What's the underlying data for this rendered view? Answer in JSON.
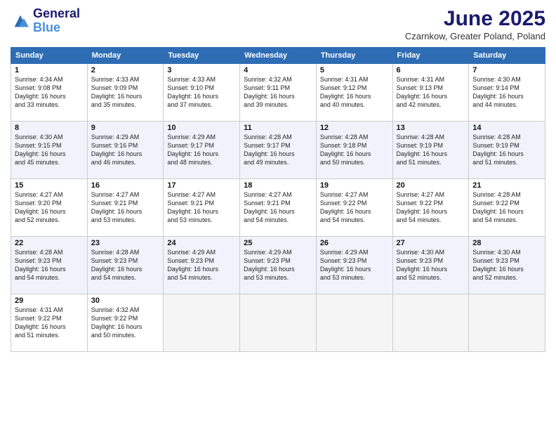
{
  "header": {
    "logo_line1": "General",
    "logo_line2": "Blue",
    "month_title": "June 2025",
    "location": "Czarnkow, Greater Poland, Poland"
  },
  "days_of_week": [
    "Sunday",
    "Monday",
    "Tuesday",
    "Wednesday",
    "Thursday",
    "Friday",
    "Saturday"
  ],
  "weeks": [
    [
      {
        "day": "1",
        "info": "Sunrise: 4:34 AM\nSunset: 9:08 PM\nDaylight: 16 hours\nand 33 minutes."
      },
      {
        "day": "2",
        "info": "Sunrise: 4:33 AM\nSunset: 9:09 PM\nDaylight: 16 hours\nand 35 minutes."
      },
      {
        "day": "3",
        "info": "Sunrise: 4:33 AM\nSunset: 9:10 PM\nDaylight: 16 hours\nand 37 minutes."
      },
      {
        "day": "4",
        "info": "Sunrise: 4:32 AM\nSunset: 9:11 PM\nDaylight: 16 hours\nand 39 minutes."
      },
      {
        "day": "5",
        "info": "Sunrise: 4:31 AM\nSunset: 9:12 PM\nDaylight: 16 hours\nand 40 minutes."
      },
      {
        "day": "6",
        "info": "Sunrise: 4:31 AM\nSunset: 9:13 PM\nDaylight: 16 hours\nand 42 minutes."
      },
      {
        "day": "7",
        "info": "Sunrise: 4:30 AM\nSunset: 9:14 PM\nDaylight: 16 hours\nand 44 minutes."
      }
    ],
    [
      {
        "day": "8",
        "info": "Sunrise: 4:30 AM\nSunset: 9:15 PM\nDaylight: 16 hours\nand 45 minutes."
      },
      {
        "day": "9",
        "info": "Sunrise: 4:29 AM\nSunset: 9:16 PM\nDaylight: 16 hours\nand 46 minutes."
      },
      {
        "day": "10",
        "info": "Sunrise: 4:29 AM\nSunset: 9:17 PM\nDaylight: 16 hours\nand 48 minutes."
      },
      {
        "day": "11",
        "info": "Sunrise: 4:28 AM\nSunset: 9:17 PM\nDaylight: 16 hours\nand 49 minutes."
      },
      {
        "day": "12",
        "info": "Sunrise: 4:28 AM\nSunset: 9:18 PM\nDaylight: 16 hours\nand 50 minutes."
      },
      {
        "day": "13",
        "info": "Sunrise: 4:28 AM\nSunset: 9:19 PM\nDaylight: 16 hours\nand 51 minutes."
      },
      {
        "day": "14",
        "info": "Sunrise: 4:28 AM\nSunset: 9:19 PM\nDaylight: 16 hours\nand 51 minutes."
      }
    ],
    [
      {
        "day": "15",
        "info": "Sunrise: 4:27 AM\nSunset: 9:20 PM\nDaylight: 16 hours\nand 52 minutes."
      },
      {
        "day": "16",
        "info": "Sunrise: 4:27 AM\nSunset: 9:21 PM\nDaylight: 16 hours\nand 53 minutes."
      },
      {
        "day": "17",
        "info": "Sunrise: 4:27 AM\nSunset: 9:21 PM\nDaylight: 16 hours\nand 53 minutes."
      },
      {
        "day": "18",
        "info": "Sunrise: 4:27 AM\nSunset: 9:21 PM\nDaylight: 16 hours\nand 54 minutes."
      },
      {
        "day": "19",
        "info": "Sunrise: 4:27 AM\nSunset: 9:22 PM\nDaylight: 16 hours\nand 54 minutes."
      },
      {
        "day": "20",
        "info": "Sunrise: 4:27 AM\nSunset: 9:22 PM\nDaylight: 16 hours\nand 54 minutes."
      },
      {
        "day": "21",
        "info": "Sunrise: 4:28 AM\nSunset: 9:22 PM\nDaylight: 16 hours\nand 54 minutes."
      }
    ],
    [
      {
        "day": "22",
        "info": "Sunrise: 4:28 AM\nSunset: 9:23 PM\nDaylight: 16 hours\nand 54 minutes."
      },
      {
        "day": "23",
        "info": "Sunrise: 4:28 AM\nSunset: 9:23 PM\nDaylight: 16 hours\nand 54 minutes."
      },
      {
        "day": "24",
        "info": "Sunrise: 4:29 AM\nSunset: 9:23 PM\nDaylight: 16 hours\nand 54 minutes."
      },
      {
        "day": "25",
        "info": "Sunrise: 4:29 AM\nSunset: 9:23 PM\nDaylight: 16 hours\nand 53 minutes."
      },
      {
        "day": "26",
        "info": "Sunrise: 4:29 AM\nSunset: 9:23 PM\nDaylight: 16 hours\nand 53 minutes."
      },
      {
        "day": "27",
        "info": "Sunrise: 4:30 AM\nSunset: 9:23 PM\nDaylight: 16 hours\nand 52 minutes."
      },
      {
        "day": "28",
        "info": "Sunrise: 4:30 AM\nSunset: 9:23 PM\nDaylight: 16 hours\nand 52 minutes."
      }
    ],
    [
      {
        "day": "29",
        "info": "Sunrise: 4:31 AM\nSunset: 9:22 PM\nDaylight: 16 hours\nand 51 minutes."
      },
      {
        "day": "30",
        "info": "Sunrise: 4:32 AM\nSunset: 9:22 PM\nDaylight: 16 hours\nand 50 minutes."
      },
      {
        "day": "",
        "info": ""
      },
      {
        "day": "",
        "info": ""
      },
      {
        "day": "",
        "info": ""
      },
      {
        "day": "",
        "info": ""
      },
      {
        "day": "",
        "info": ""
      }
    ]
  ]
}
